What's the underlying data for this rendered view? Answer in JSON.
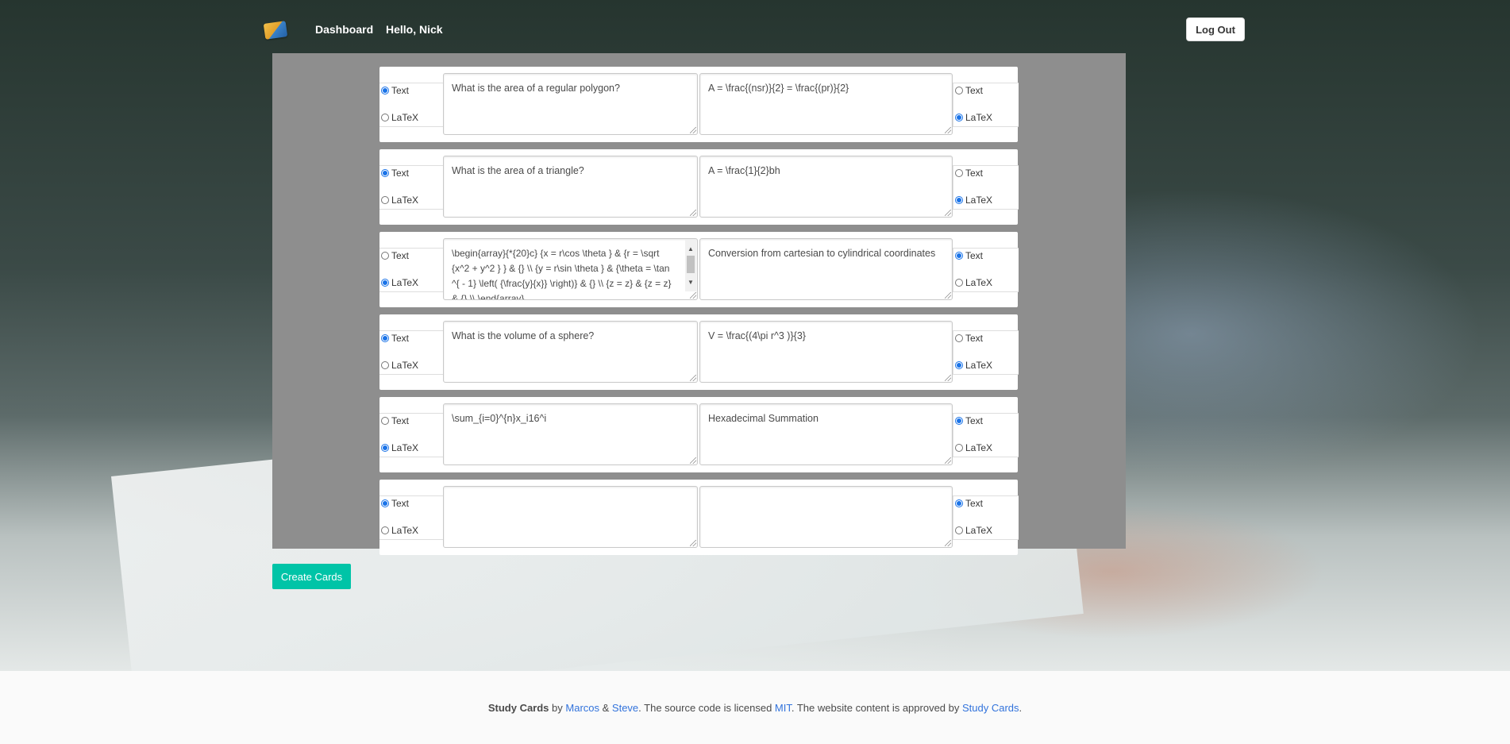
{
  "nav": {
    "dashboard": "Dashboard",
    "greeting": "Hello, Nick",
    "logout": "Log Out"
  },
  "cards": [
    {
      "front_mode": "Text",
      "front": "What is the area of a regular polygon?",
      "back": "A = \\frac{(nsr)}{2} = \\frac{(pr)}{2}",
      "back_mode": "LaTeX"
    },
    {
      "front_mode": "Text",
      "front": "What is the area of a triangle?",
      "back": "A = \\frac{1}{2}bh",
      "back_mode": "LaTeX"
    },
    {
      "front_mode": "LaTeX",
      "front": "\\begin{array}{*{20}c} {x = r\\cos \\theta } & {r = \\sqrt {x^2 + y^2 } } & {} \\\\ {y = r\\sin \\theta } & {\\theta = \\tan ^{ - 1} \\left( {\\frac{y}{x}} \\right)} & {} \\\\ {z = z} & {z = z} & {} \\\\ \\end{array}",
      "back": "Conversion from cartesian to cylindrical coordinates",
      "back_mode": "Text"
    },
    {
      "front_mode": "Text",
      "front": "What is the volume of a sphere?",
      "back": "V = \\frac{(4\\pi r^3 )}{3}",
      "back_mode": "LaTeX"
    },
    {
      "front_mode": "LaTeX",
      "front": "\\sum_{i=0}^{n}x_i16^i",
      "back": "Hexadecimal Summation",
      "back_mode": "Text"
    },
    {
      "front_mode": "Text",
      "front": "",
      "back": "",
      "back_mode": "Text"
    }
  ],
  "radio_labels": {
    "text": "Text",
    "latex": "LaTeX"
  },
  "create_button": "Create Cards",
  "footer": {
    "brand": "Study Cards",
    "by": " by ",
    "author1": "Marcos",
    "amp": " & ",
    "author2": "Steve",
    "license_text": ". The source code is licensed ",
    "license": "MIT",
    "content_text": ". The website content is approved by ",
    "approver": "Study Cards",
    "end": "."
  }
}
